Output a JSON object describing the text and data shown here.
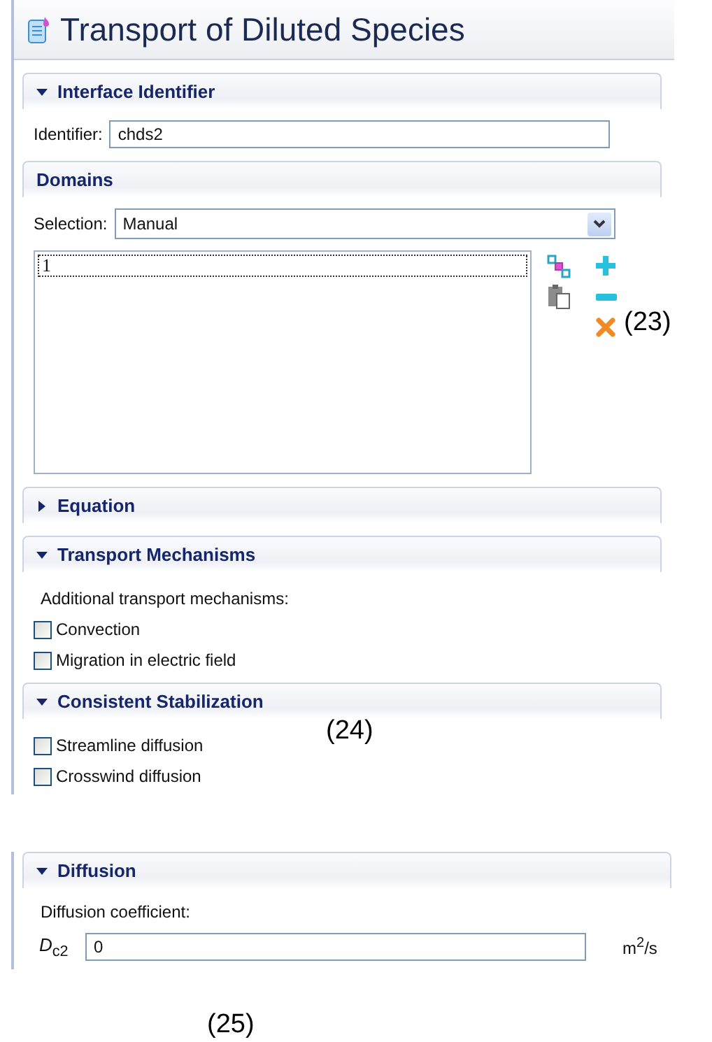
{
  "title": "Transport of Diluted Species",
  "interface_identifier": {
    "header": "Interface Identifier",
    "expanded": true,
    "label": "Identifier:",
    "value": "chds2"
  },
  "domains": {
    "header": "Domains",
    "selection_label": "Selection:",
    "selection_value": "Manual",
    "list_items": [
      "1"
    ]
  },
  "equation": {
    "header": "Equation",
    "expanded": false
  },
  "transport_mechanisms": {
    "header": "Transport Mechanisms",
    "expanded": true,
    "text": "Additional transport mechanisms:",
    "options": [
      {
        "label": "Convection",
        "checked": false
      },
      {
        "label": "Migration in electric field",
        "checked": false
      }
    ]
  },
  "consistent_stabilization": {
    "header": "Consistent Stabilization",
    "expanded": true,
    "options": [
      {
        "label": "Streamline diffusion",
        "checked": false
      },
      {
        "label": "Crosswind diffusion",
        "checked": false
      }
    ]
  },
  "diffusion": {
    "header": "Diffusion",
    "expanded": true,
    "text": "Diffusion coefficient:",
    "symbol": "*D*$_{c2}$",
    "value": "0",
    "unit": "m$^{2}$/s"
  },
  "annotations": [
    "(23)",
    "(24)",
    "(25)"
  ]
}
